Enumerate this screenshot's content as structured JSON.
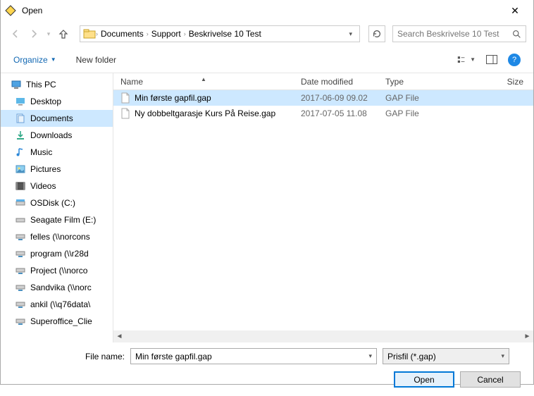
{
  "window": {
    "title": "Open"
  },
  "breadcrumbs": {
    "b0": "Documents",
    "b1": "Support",
    "b2": "Beskrivelse 10 Test"
  },
  "search": {
    "placeholder": "Search Beskrivelse 10 Test"
  },
  "toolbar": {
    "organize": "Organize",
    "newfolder": "New folder"
  },
  "tree": {
    "root": "This PC",
    "i0": "Desktop",
    "i1": "Documents",
    "i2": "Downloads",
    "i3": "Music",
    "i4": "Pictures",
    "i5": "Videos",
    "i6": "OSDisk (C:)",
    "i7": "Seagate Film (E:)",
    "i8": "felles (\\\\norcons",
    "i9": "program (\\\\r28d",
    "i10": "Project (\\\\norco",
    "i11": "Sandvika (\\\\norc",
    "i12": "ankil (\\\\q76data\\",
    "i13": "Superoffice_Clie"
  },
  "columns": {
    "name": "Name",
    "date": "Date modified",
    "type": "Type",
    "size": "Size"
  },
  "files": {
    "f0": {
      "name": "Min første gapfil.gap",
      "date": "2017-06-09 09.02",
      "type": "GAP File"
    },
    "f1": {
      "name": "Ny dobbeltgarasje Kurs På Reise.gap",
      "date": "2017-07-05 11.08",
      "type": "GAP File"
    }
  },
  "footer": {
    "filename_label": "File name:",
    "filename_value": "Min første gapfil.gap",
    "filter": "Prisfil (*.gap)",
    "open": "Open",
    "cancel": "Cancel"
  }
}
